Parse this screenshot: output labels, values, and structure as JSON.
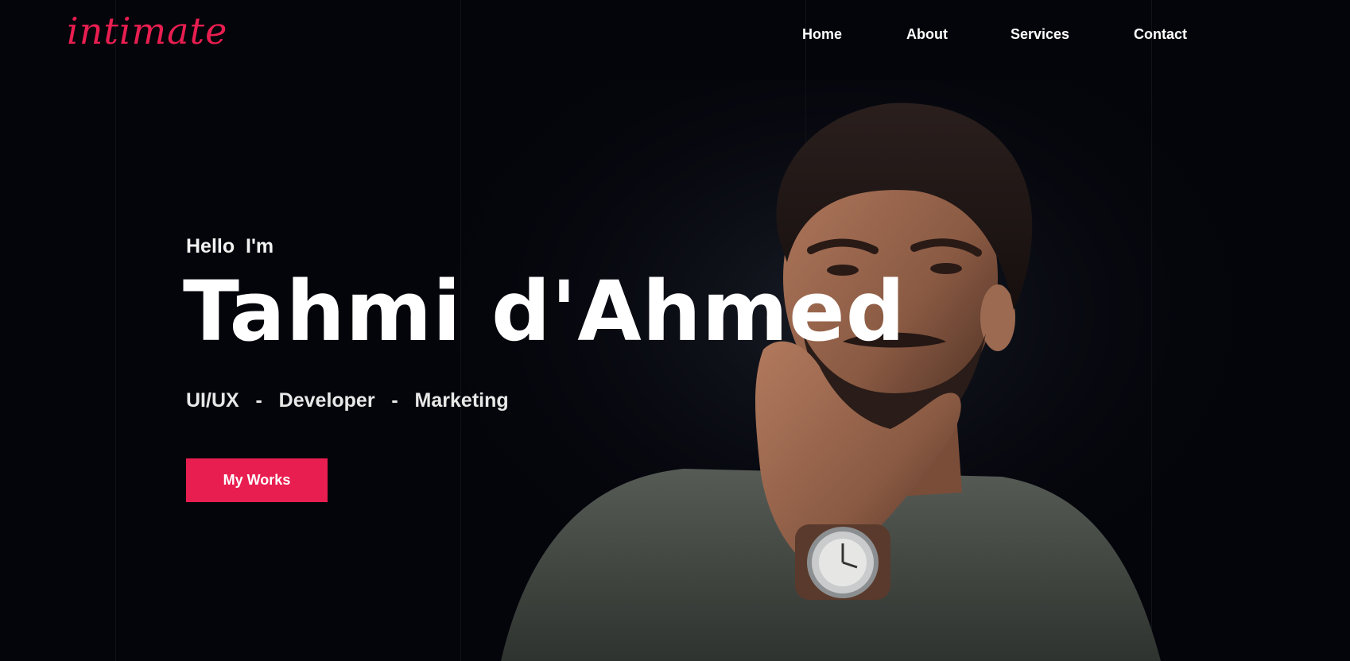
{
  "brand": {
    "logo_text": "intimate",
    "accent": "#e91e50"
  },
  "nav": {
    "items": [
      {
        "label": "Home"
      },
      {
        "label": "About"
      },
      {
        "label": "Services"
      },
      {
        "label": "Contact"
      }
    ]
  },
  "hero": {
    "greeting": "Hello  I'm",
    "name": "Tahmi d'Ahmed",
    "roles": "UI/UX   -   Developer   -   Marketing",
    "cta_label": "My Works"
  },
  "colors": {
    "background": "#04050b",
    "text": "#ffffff"
  }
}
